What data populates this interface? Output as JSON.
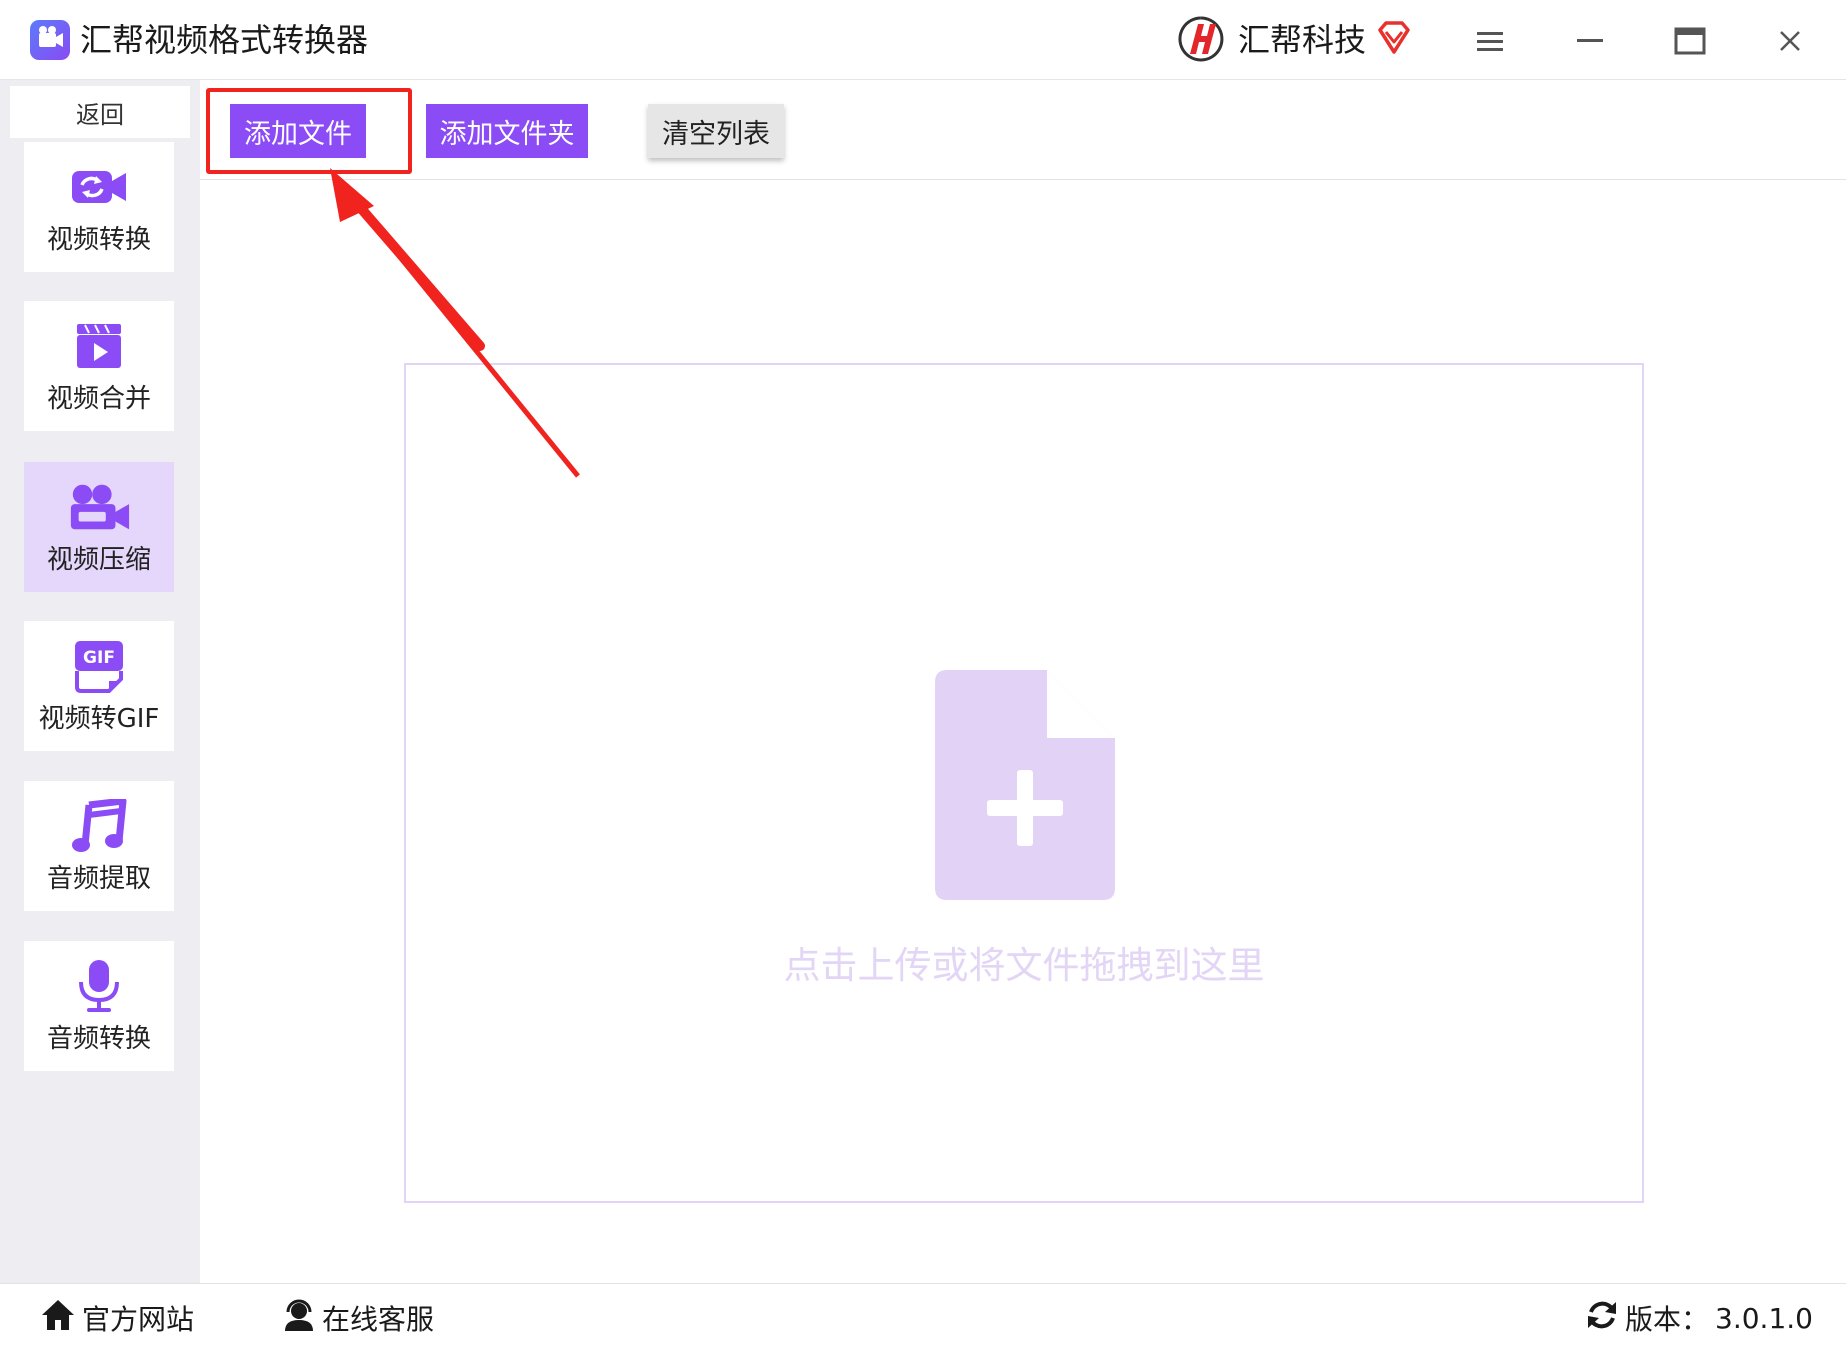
{
  "app": {
    "title": "汇帮视频格式转换器",
    "brand": "汇帮科技"
  },
  "sidebar": {
    "back_label": "返回",
    "items": [
      {
        "label": "视频转换",
        "icon": "video-convert-icon",
        "active": false
      },
      {
        "label": "视频合并",
        "icon": "video-merge-icon",
        "active": false
      },
      {
        "label": "视频压缩",
        "icon": "video-compress-icon",
        "active": true
      },
      {
        "label": "视频转GIF",
        "icon": "gif-icon",
        "active": false
      },
      {
        "label": "音频提取",
        "icon": "music-note-icon",
        "active": false
      },
      {
        "label": "音频转换",
        "icon": "microphone-icon",
        "active": false
      }
    ]
  },
  "toolbar": {
    "add_file": "添加文件",
    "add_folder": "添加文件夹",
    "clear_list": "清空列表"
  },
  "dropzone": {
    "hint": "点击上传或将文件拖拽到这里",
    "icon": "file-add-icon"
  },
  "footer": {
    "website": "官方网站",
    "support": "在线客服",
    "version_label": "版本：",
    "version": "3.0.1.0"
  },
  "colors": {
    "primary": "#8b4cf6",
    "active_nav": "#e5d7fb",
    "upload_icon": "#e2d3f6",
    "annotation_red": "#f0231f"
  }
}
